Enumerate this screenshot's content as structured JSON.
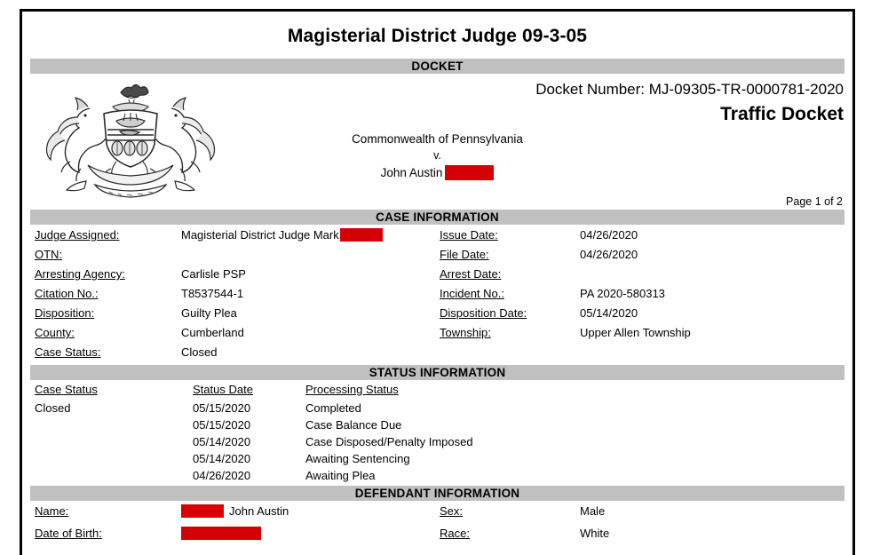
{
  "document": {
    "title": "Magisterial District Judge 09-3-05",
    "docket_bar": "DOCKET",
    "docket_number": "Docket Number: MJ-09305-TR-0000781-2020",
    "docket_type": "Traffic Docket",
    "commonwealth": "Commonwealth of Pennsylvania",
    "versus": "v.",
    "defendant_name": "John Austin",
    "page_of": "Page 1 of 2",
    "seal_icon": "pennsylvania-coat-of-arms-icon",
    "redaction_color": "#d30105",
    "section_bar_color": "#c0c0c0"
  },
  "case_information": {
    "heading": "CASE INFORMATION",
    "left": [
      {
        "label": "Judge Assigned:",
        "value": "Magisterial District Judge Mark",
        "redacted_after": true
      },
      {
        "label": "OTN:",
        "value": ""
      },
      {
        "label": "Arresting Agency:",
        "value": "Carlisle PSP"
      },
      {
        "label": "Citation No.:",
        "value": "T8537544-1"
      },
      {
        "label": "Disposition:",
        "value": "Guilty Plea"
      },
      {
        "label": "County:",
        "value": "Cumberland"
      },
      {
        "label": "Case Status:",
        "value": "Closed"
      }
    ],
    "right": [
      {
        "label": "Issue Date:",
        "value": "04/26/2020"
      },
      {
        "label": "File Date:",
        "value": "04/26/2020"
      },
      {
        "label": "Arrest Date:",
        "value": ""
      },
      {
        "label": "Incident No.:",
        "value": "PA 2020-580313"
      },
      {
        "label": "Disposition Date:",
        "value": "05/14/2020"
      },
      {
        "label": "Township:",
        "value": "Upper Allen Township"
      }
    ]
  },
  "status_information": {
    "heading": "STATUS INFORMATION",
    "columns": [
      "Case Status",
      "Status Date",
      "Processing Status"
    ],
    "case_status": "Closed",
    "rows": [
      {
        "date": "05/15/2020",
        "status": "Completed"
      },
      {
        "date": "05/15/2020",
        "status": "Case Balance Due"
      },
      {
        "date": "05/14/2020",
        "status": "Case Disposed/Penalty Imposed"
      },
      {
        "date": "05/14/2020",
        "status": "Awaiting Sentencing"
      },
      {
        "date": "04/26/2020",
        "status": "Awaiting Plea"
      }
    ]
  },
  "defendant_information": {
    "heading": "DEFENDANT INFORMATION",
    "name_label": "Name:",
    "name_value": "John Austin",
    "dob_label": "Date of Birth:",
    "dob_value": "",
    "sex_label": "Sex:",
    "sex_value": "Male",
    "race_label": "Race:",
    "race_value": "White"
  }
}
